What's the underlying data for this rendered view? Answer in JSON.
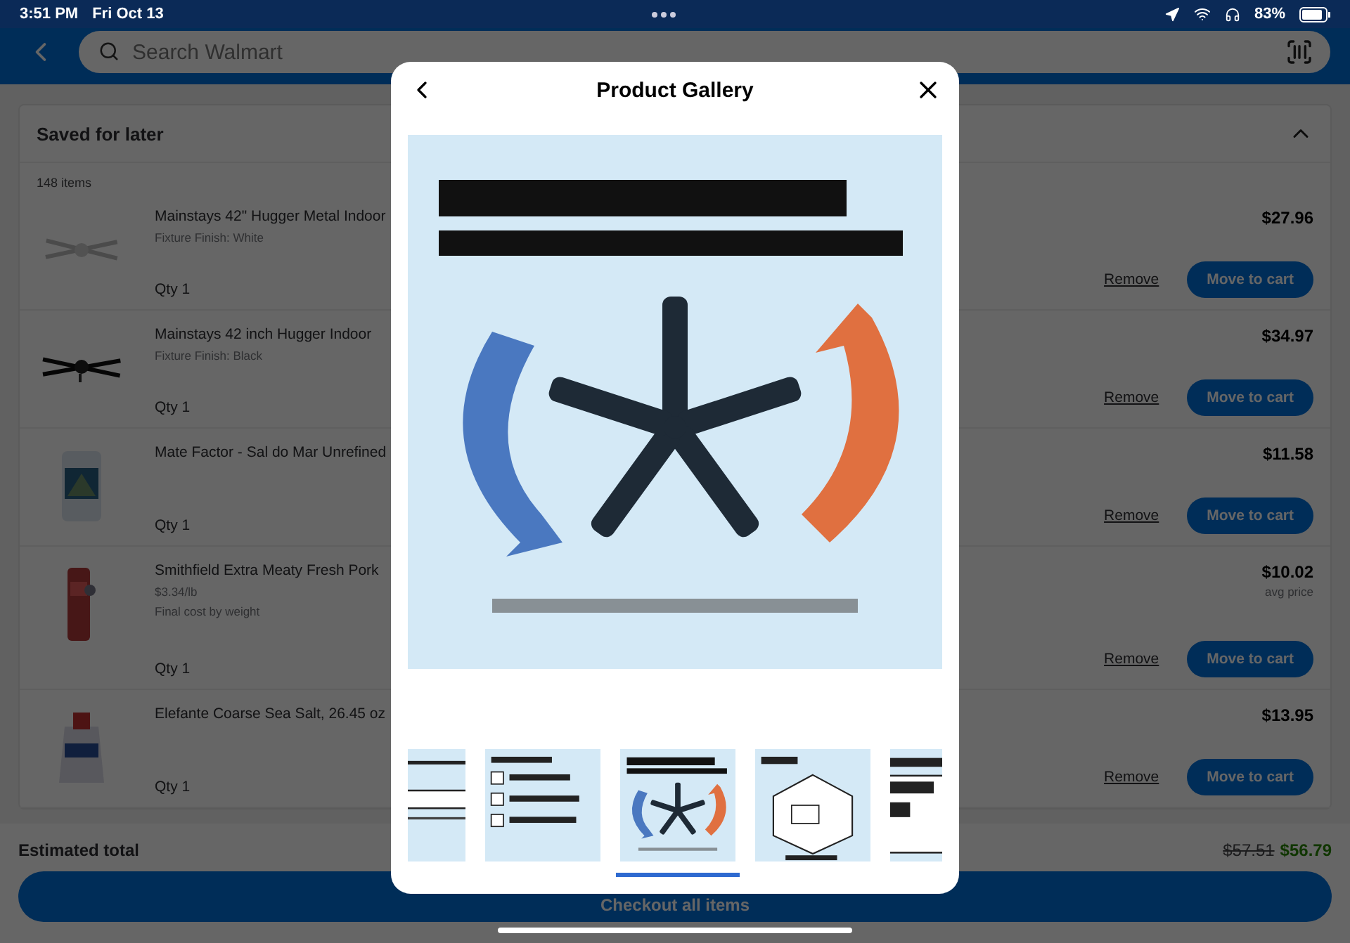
{
  "status_bar": {
    "time": "3:51 PM",
    "date": "Fri Oct 13",
    "battery": "83%"
  },
  "header": {
    "search_placeholder": "Search Walmart"
  },
  "saved": {
    "title": "Saved for later",
    "count": "148 items",
    "expanded": true,
    "items": [
      {
        "name": "Mainstays 42\" Hugger Metal Indoor",
        "details": [
          "Fixture Finish: White"
        ],
        "qty": "Qty 1",
        "price": "$27.96",
        "remove": "Remove",
        "move": "Move to cart"
      },
      {
        "name": "Mainstays 42 inch Hugger Indoor",
        "details": [
          "Fixture Finish: Black"
        ],
        "qty": "Qty 1",
        "price": "$34.97",
        "remove": "Remove",
        "move": "Move to cart"
      },
      {
        "name": "Mate Factor - Sal do Mar Unrefined",
        "qty": "Qty 1",
        "price": "$11.58",
        "remove": "Remove",
        "move": "Move to cart"
      },
      {
        "name": "Smithfield Extra Meaty Fresh Pork",
        "details": [
          "$3.34/lb",
          "Final cost by weight"
        ],
        "qty": "Qty 1",
        "price": "$10.02",
        "price_note": "avg price",
        "remove": "Remove",
        "move": "Move to cart"
      },
      {
        "name": "Elefante Coarse Sea Salt, 26.45 oz",
        "qty": "Qty 1",
        "price": "$13.95",
        "remove": "Remove",
        "move": "Move to cart"
      }
    ]
  },
  "footer": {
    "label": "Estimated total",
    "original_total": "$57.51",
    "total": "$56.79",
    "checkout": "Checkout all items"
  },
  "gallery": {
    "title": "Product Gallery",
    "main_image": {
      "kind": "picture"
    },
    "thumbnails": [
      {
        "kind": "picture",
        "selected": false
      },
      {
        "kind": "picture",
        "selected": false
      },
      {
        "kind": "picture",
        "selected": true
      },
      {
        "kind": "picture",
        "selected": false
      },
      {
        "kind": "picture",
        "selected": false
      }
    ]
  }
}
